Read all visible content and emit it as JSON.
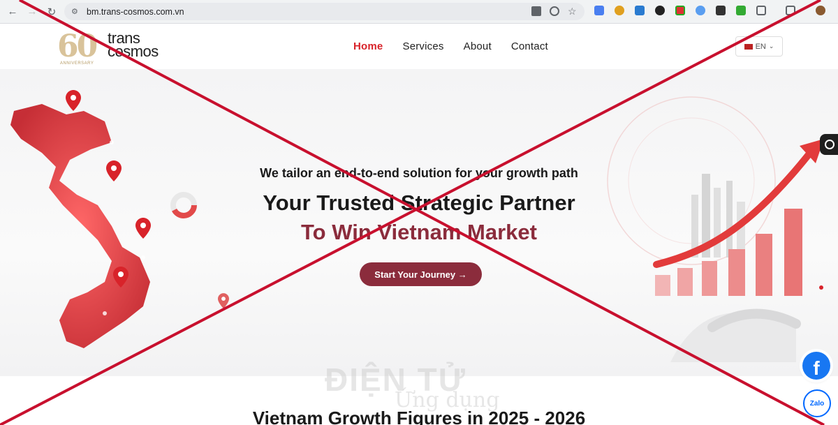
{
  "browser": {
    "url": "bm.trans-cosmos.com.vn"
  },
  "logo": {
    "sixty": "60",
    "anniversary": "ANNIVERSARY",
    "brand_line1": "trans",
    "brand_line2": "cosmos"
  },
  "nav": {
    "items": [
      "Home",
      "Services",
      "About",
      "Contact"
    ]
  },
  "language": {
    "label": "EN"
  },
  "hero": {
    "eyebrow": "We tailor an end-to-end solution for your growth path",
    "headline": "Your Trusted Strategic Partner",
    "subhead": "To Win Vietnam Market",
    "cta_label": "Start Your Journey →"
  },
  "watermark": {
    "line1": "ĐIỆN TỬ",
    "line2": "Ứng dụng"
  },
  "section": {
    "title": "Vietnam Growth Figures in 2025 - 2026"
  },
  "social": {
    "facebook": "f",
    "zalo": "Zalo"
  },
  "colors": {
    "accent_red": "#d8232a",
    "brand_maroon": "#8b2c3c",
    "cross_red": "#c8102e"
  }
}
